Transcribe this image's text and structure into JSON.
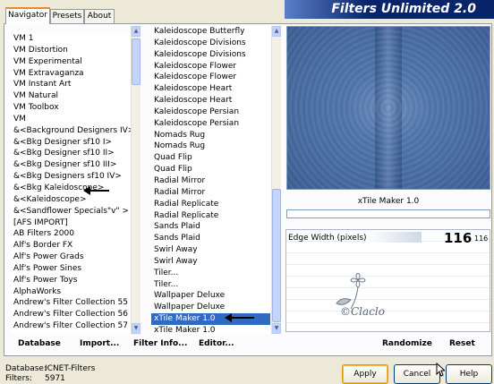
{
  "header": {
    "title": "Filters Unlimited 2.0"
  },
  "tabs": [
    {
      "label": "Navigator",
      "active": true
    },
    {
      "label": "Presets",
      "active": false
    },
    {
      "label": "About",
      "active": false
    }
  ],
  "categories": {
    "items": [
      "VM 1",
      "VM Distortion",
      "VM Experimental",
      "VM Extravaganza",
      "VM Instant Art",
      "VM Natural",
      "VM Toolbox",
      "VM",
      "&<Background Designers IV>",
      "&<Bkg Designer sf10 I>",
      "&<Bkg Designer sf10 II>",
      "&<Bkg Designer sf10 III>",
      "&<Bkg Designers sf10 IV>",
      "&<Bkg Kaleidoscope>",
      "&<Kaleidoscope>",
      "&<Sandflower Specials\"v\" >",
      "[AFS IMPORT]",
      "AB Filters 2000",
      "Alf's Border FX",
      "Alf's Power Grads",
      "Alf's Power Sines",
      "Alf's Power Toys",
      "AlphaWorks",
      "Andrew's Filter Collection 55",
      "Andrew's Filter Collection 56",
      "Andrew's Filter Collection 57"
    ]
  },
  "filters": {
    "items": [
      "Kaleidoscope Butterfly",
      "Kaleidoscope Divisions",
      "Kaleidoscope Divisions",
      "Kaleidoscope Flower",
      "Kaleidoscope Flower",
      "Kaleidoscope Heart",
      "Kaleidoscope Heart",
      "Kaleidoscope Persian",
      "Kaleidoscope Persian",
      "Nomads Rug",
      "Nomads Rug",
      "Quad Flip",
      "Quad Flip",
      "Radial Mirror",
      "Radial Mirror",
      "Radial Replicate",
      "Radial Replicate",
      "Sands Plaid",
      "Sands Plaid",
      "Swirl Away",
      "Swirl Away",
      "Tiler...",
      "Tiler...",
      "Wallpaper Deluxe",
      "Wallpaper Deluxe",
      "xTile Maker 1.0",
      "xTile Maker 1.0"
    ]
  },
  "preview": {
    "filter_name": "xTile Maker 1.0"
  },
  "param": {
    "label": "Edge Width (pixels):",
    "value_big": "116",
    "value_small": "116"
  },
  "watermark": {
    "text": "©Claclo"
  },
  "bottom_buttons": {
    "database": "Database",
    "import": "Import...",
    "filter_info": "Filter Info...",
    "editor": "Editor...",
    "randomize": "Randomize",
    "reset": "Reset"
  },
  "status": {
    "database_label": "Database:",
    "database_value": "ICNET-Filters",
    "filters_label": "Filters:",
    "filters_value": "5971"
  },
  "dialog": {
    "apply": "Apply",
    "cancel": "Cancel",
    "help": "Help"
  },
  "colors": {
    "accent": "#316ac5",
    "header_bg": "#0a246a",
    "preview": "#4f73a8"
  }
}
